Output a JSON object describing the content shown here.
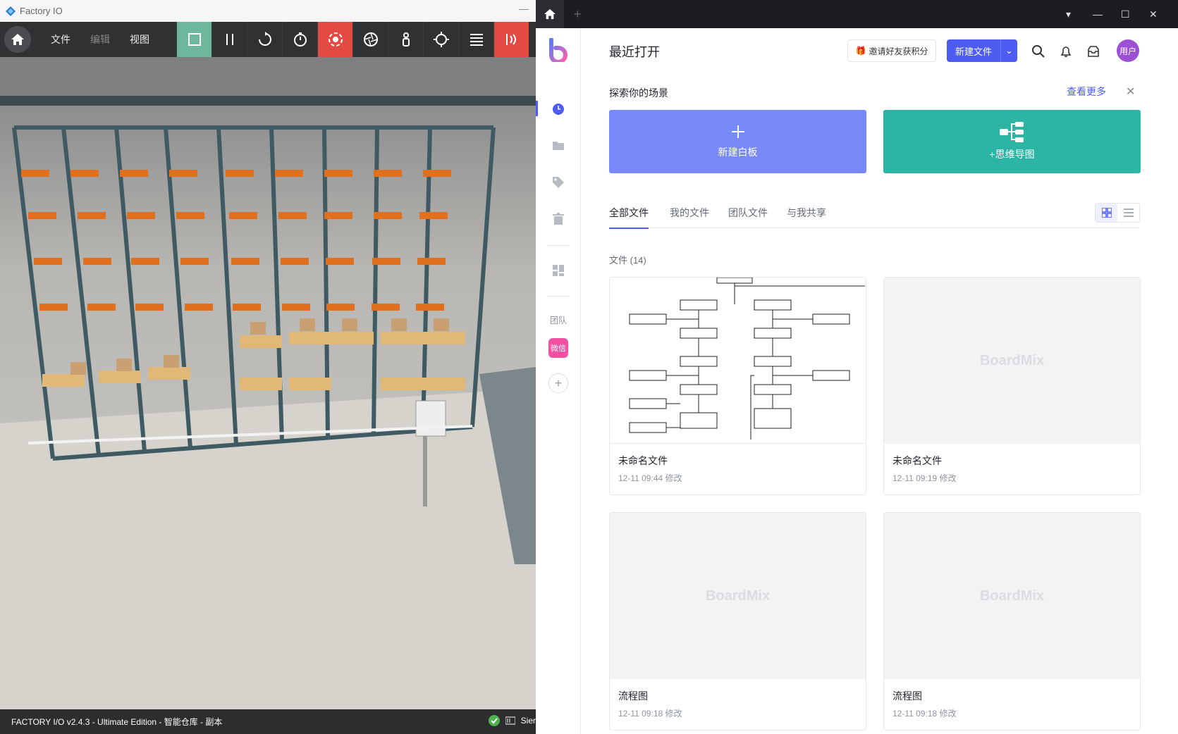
{
  "factory": {
    "title": "Factory IO",
    "menu": {
      "file": "文件",
      "edit": "编辑",
      "view": "视图"
    },
    "status": "FACTORY I/O v2.4.3 - Ultimate Edition - 智能仓库 - 副本",
    "status_right": "Sier"
  },
  "boardmix": {
    "page_title": "最近打开",
    "invite": "邀请好友获积分",
    "new_file": "新建文件",
    "avatar": "用户",
    "sidebar": {
      "team": "团队",
      "wechat": "微信"
    },
    "explore": {
      "title": "探索你的场景",
      "see_more": "查看更多",
      "cards": [
        {
          "label": "新建白板",
          "color": "#7889f8"
        },
        {
          "label": "+思维导图",
          "color": "#2cb5a5"
        }
      ]
    },
    "tabs": [
      "全部文件",
      "我的文件",
      "团队文件",
      "与我共享"
    ],
    "files_count": "文件 (14)",
    "files": [
      {
        "name": "未命名文件",
        "date": "12-11 09:44 修改",
        "thumb": "flowchart"
      },
      {
        "name": "未命名文件",
        "date": "12-11 09:19 修改",
        "thumb": "BoardMix"
      },
      {
        "name": "流程图",
        "date": "12-11 09:18 修改",
        "thumb": "BoardMix"
      },
      {
        "name": "流程图",
        "date": "12-11 09:18 修改",
        "thumb": "BoardMix"
      }
    ],
    "accent": "#4e5cf2"
  }
}
